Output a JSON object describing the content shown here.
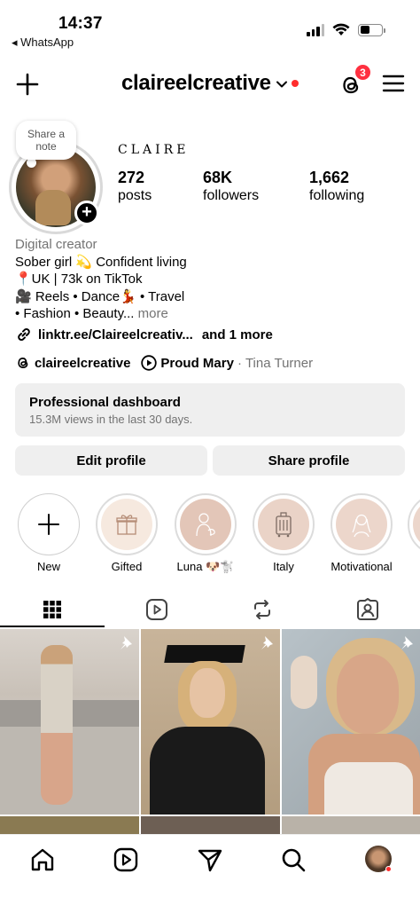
{
  "status_bar": {
    "time": "14:37",
    "back_app": "◂ WhatsApp"
  },
  "header": {
    "username": "claireelcreative",
    "notification_count": "3"
  },
  "profile": {
    "note": "Share a note",
    "display_name": "CLAIRE",
    "stats": [
      {
        "value": "272",
        "label": "posts"
      },
      {
        "value": "68K",
        "label": "followers"
      },
      {
        "value": "1,662",
        "label": "following"
      }
    ],
    "bio": {
      "category": "Digital creator",
      "line1": "Sober girl 💫 Confident living",
      "line2": "📍UK | 73k on TikTok",
      "line3": "🎥 Reels • Dance💃 • Travel",
      "line4": "• Fashion • Beauty...",
      "more": "more"
    },
    "link": {
      "text": "linktr.ee/Claireelcreativ...",
      "extra": "and 1 more"
    },
    "threads_handle": "claireelcreative",
    "music": {
      "song": "Proud Mary",
      "separator": " · ",
      "artist": "Tina Turner"
    }
  },
  "dashboard": {
    "title": "Professional dashboard",
    "subtitle": "15.3M views in the last 30 days."
  },
  "buttons": {
    "edit": "Edit profile",
    "share": "Share profile"
  },
  "highlights": [
    {
      "label": "New"
    },
    {
      "label": "Gifted"
    },
    {
      "label": "Luna 🐶🐩"
    },
    {
      "label": "Italy"
    },
    {
      "label": "Motivational"
    }
  ],
  "tabs": [
    "grid-icon",
    "reels-icon",
    "reposts-icon",
    "tagged-icon"
  ],
  "colors": {
    "accent_red": "#ff2d2d",
    "badge_red": "#ff3040",
    "highlight_bg": "#ecd6cb",
    "gray_button": "#efefef",
    "secondary_text": "#737373"
  }
}
